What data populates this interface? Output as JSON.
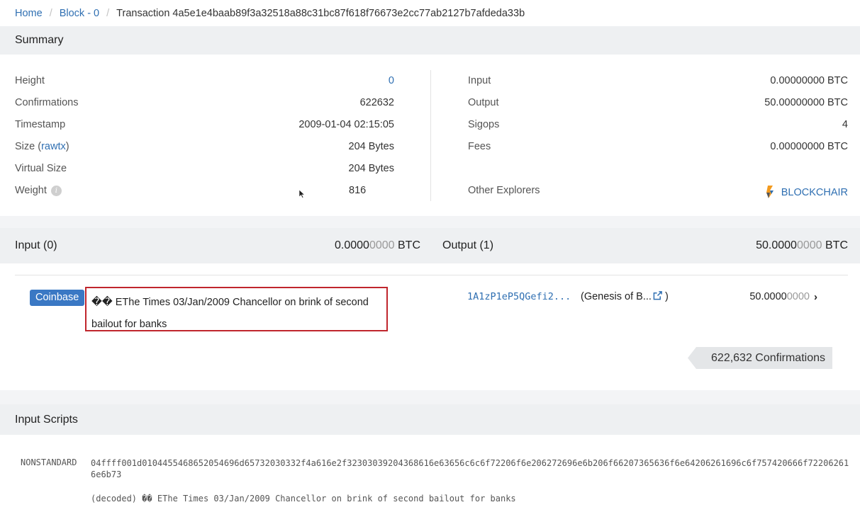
{
  "breadcrumb": {
    "home": "Home",
    "block": "Block - 0",
    "current": "Transaction 4a5e1e4baab89f3a32518a88c31bc87f618f76673e2cc77ab2127b7afdeda33b"
  },
  "summary": {
    "title": "Summary",
    "left": [
      {
        "label": "Height",
        "value": "0"
      },
      {
        "label": "Confirmations",
        "value": "622632"
      },
      {
        "label": "Timestamp",
        "value": "2009-01-04 02:15:05"
      },
      {
        "label": "Size",
        "label_link": "rawtx",
        "value": "204 Bytes"
      },
      {
        "label": "Virtual Size",
        "value": "204 Bytes"
      },
      {
        "label": "Weight",
        "value": "816"
      }
    ],
    "right": [
      {
        "label": "Input",
        "value": "0.00000000 BTC"
      },
      {
        "label": "Output",
        "value": "50.00000000 BTC"
      },
      {
        "label": "Sigops",
        "value": "4"
      },
      {
        "label": "Fees",
        "value": "0.00000000 BTC"
      },
      {
        "label": "Other Explorers",
        "value": "BLOCKCHAIR"
      }
    ]
  },
  "io": {
    "input_title": "Input (0)",
    "input_amount_main": "0.0000",
    "input_amount_dim": "0000",
    "input_amount_unit": " BTC",
    "output_title": "Output (1)",
    "output_amount_main": "50.0000",
    "output_amount_dim": "0000",
    "output_amount_unit": " BTC"
  },
  "tx": {
    "coinbase_label": "Coinbase",
    "coinbase_text": "��  EThe Times 03/Jan/2009 Chancellor on brink of second bailout for banks",
    "output_address": "1A1zP1eP5QGefi2...",
    "output_tag": "(Genesis of B...",
    "output_tag_close": " )",
    "output_value_main": "50.0000",
    "output_value_dim": "0000",
    "confirmations_badge": "622,632 Confirmations"
  },
  "input_scripts": {
    "title": "Input Scripts",
    "type": "NONSTANDARD",
    "hex": "04ffff001d0104455468652054696d65732030332f4a616e2f32303039204368616e63656c6c6f72206f6e206272696e6b206f66207365636f6e64206261696c6f757420666f722062616e6b73",
    "decoded": "(decoded) �� EThe Times 03/Jan/2009 Chancellor on brink of second bailout for banks"
  },
  "colors": {
    "link": "#2f6fb2",
    "badge": "#3a78c4",
    "highlight_border": "#c0262d",
    "band": "#eef0f2"
  }
}
